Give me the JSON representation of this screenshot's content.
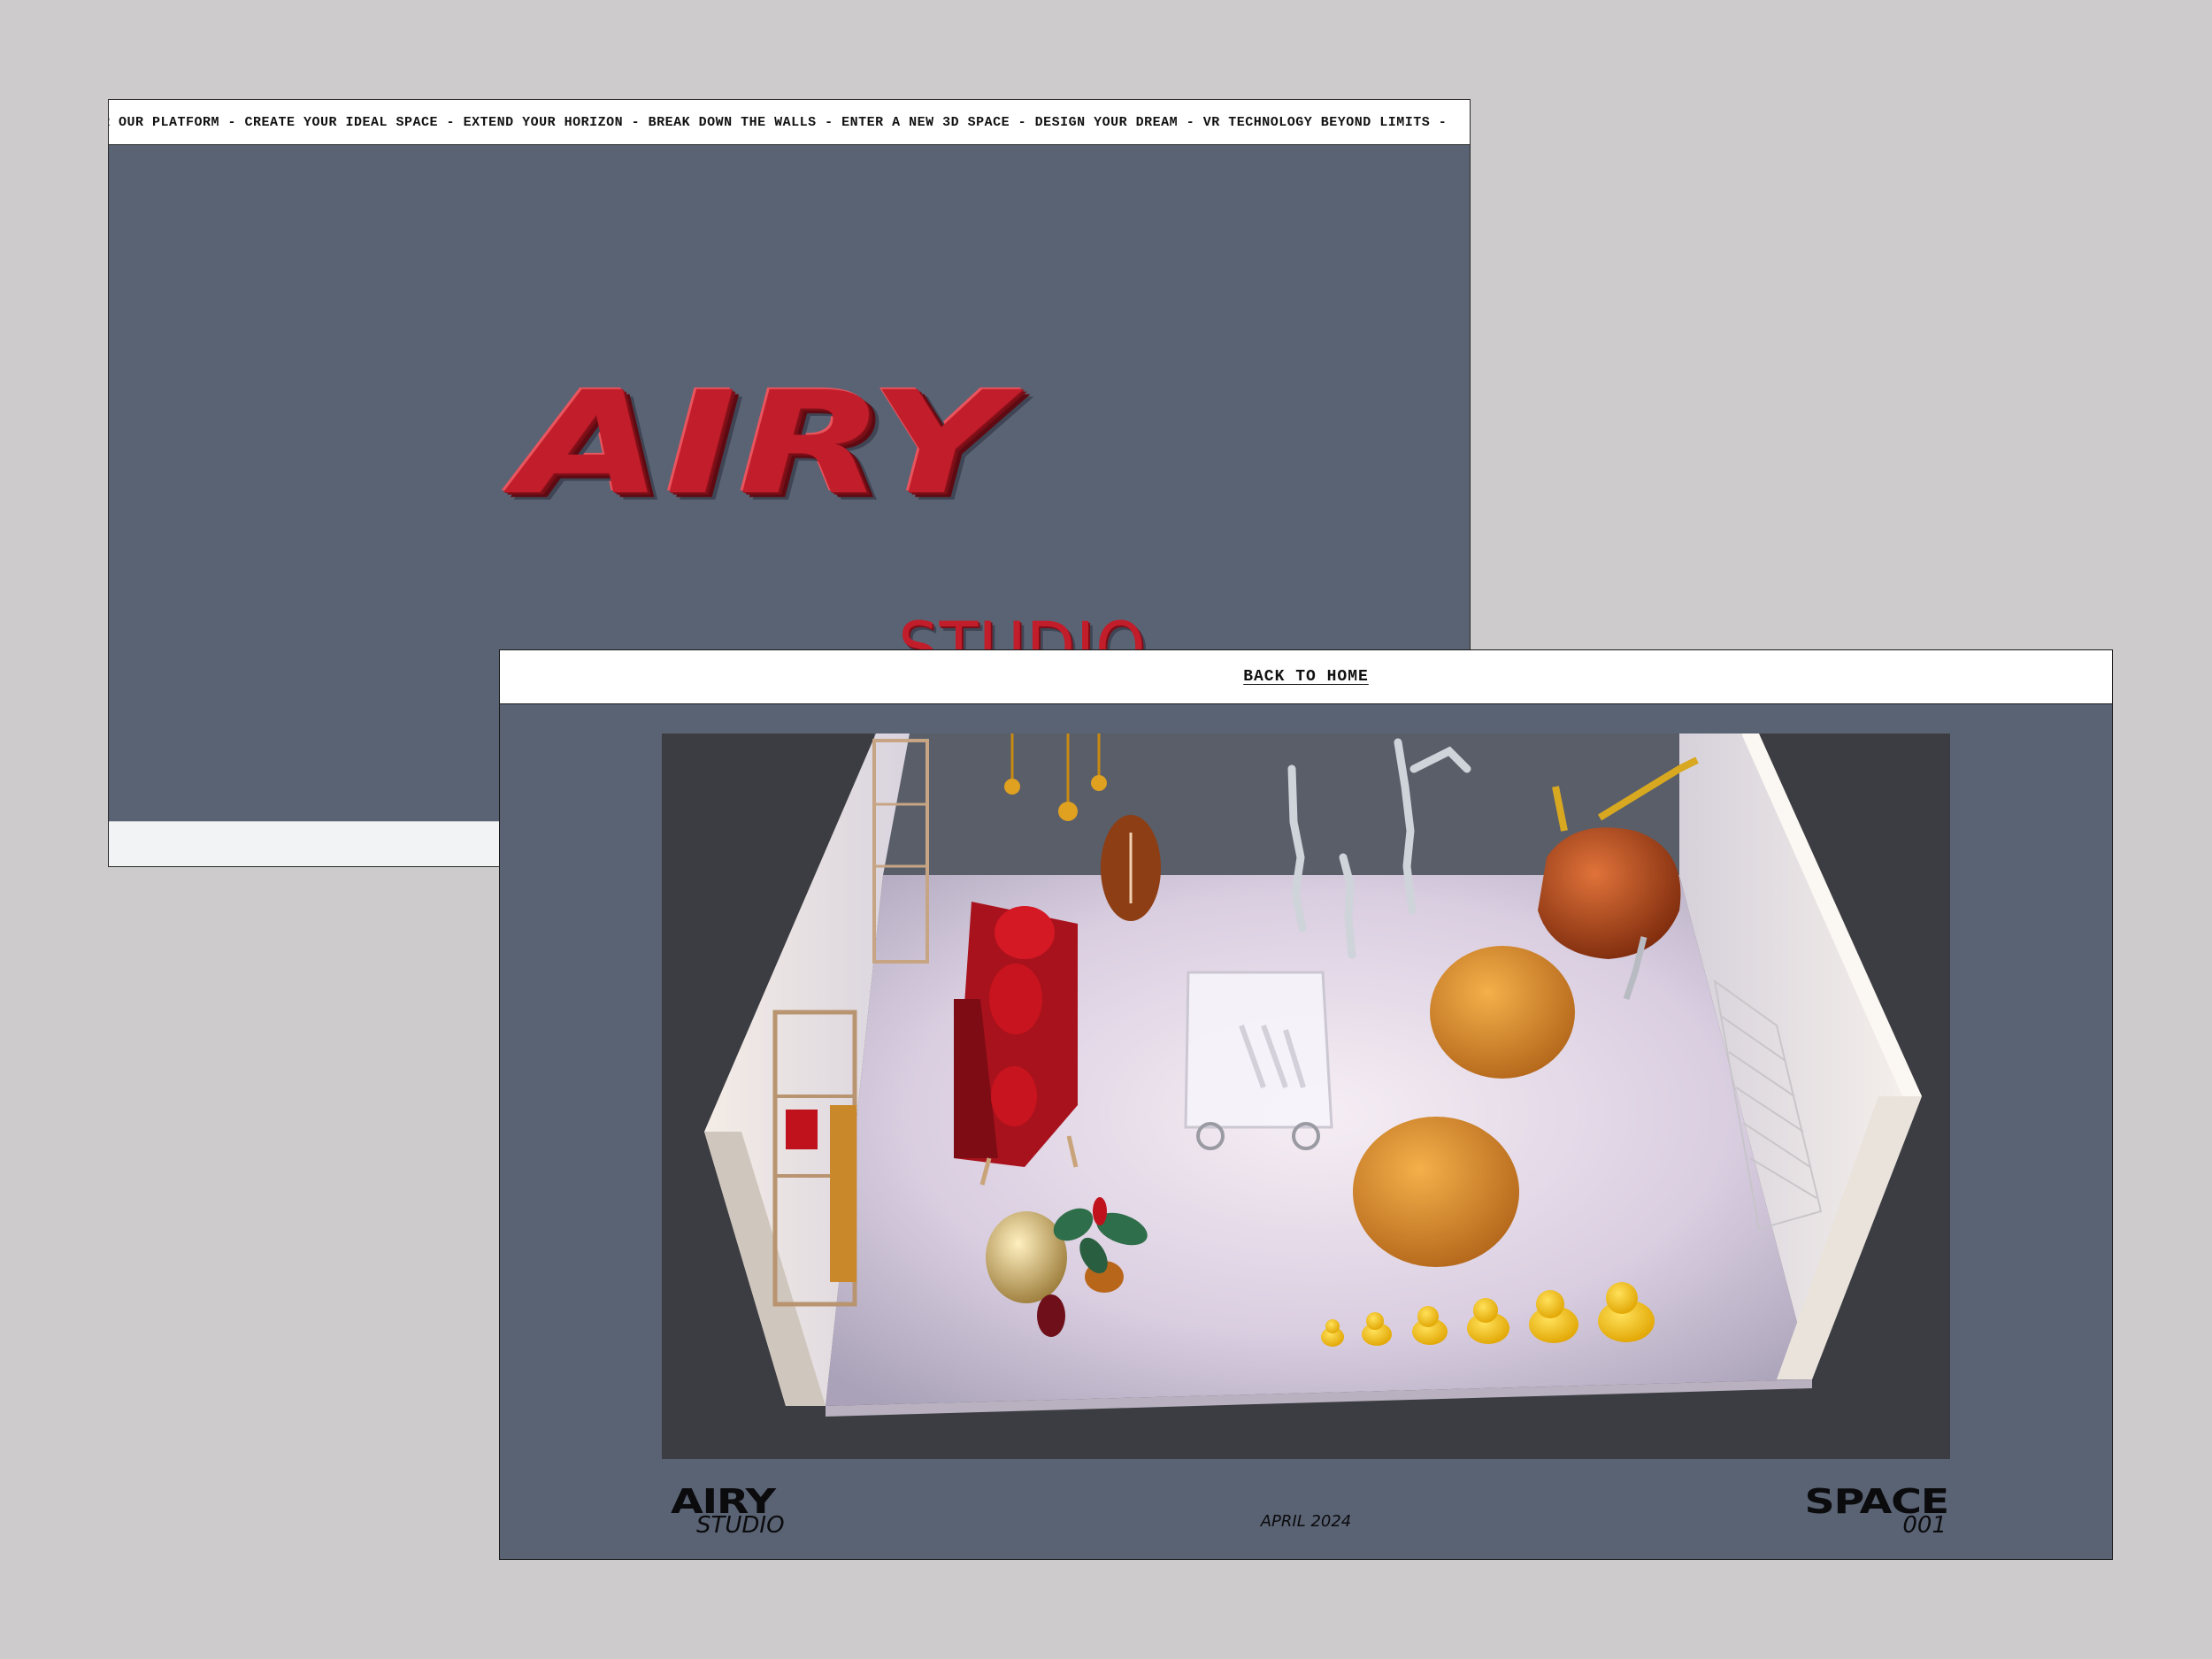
{
  "ticker": {
    "text": "R OUR PLATFORM - CREATE YOUR IDEAL SPACE - EXTEND YOUR HORIZON - BREAK DOWN THE WALLS - ENTER A NEW 3D SPACE - DESIGN YOUR DREAM - VR TECHNOLOGY BEYOND LIMITS -"
  },
  "hero": {
    "brand": "AIRY",
    "sub": "STUDIO"
  },
  "nav": {
    "back_home": "BACK TO HOME"
  },
  "footer": {
    "brand": "AIRY",
    "brand_sub": "STUDIO",
    "date": "APRIL 2024",
    "space": "SPACE",
    "space_num": "001"
  },
  "colors": {
    "slate": "#5a6374",
    "brand_red": "#c21d2a",
    "backdrop": "#cdcbcc"
  }
}
